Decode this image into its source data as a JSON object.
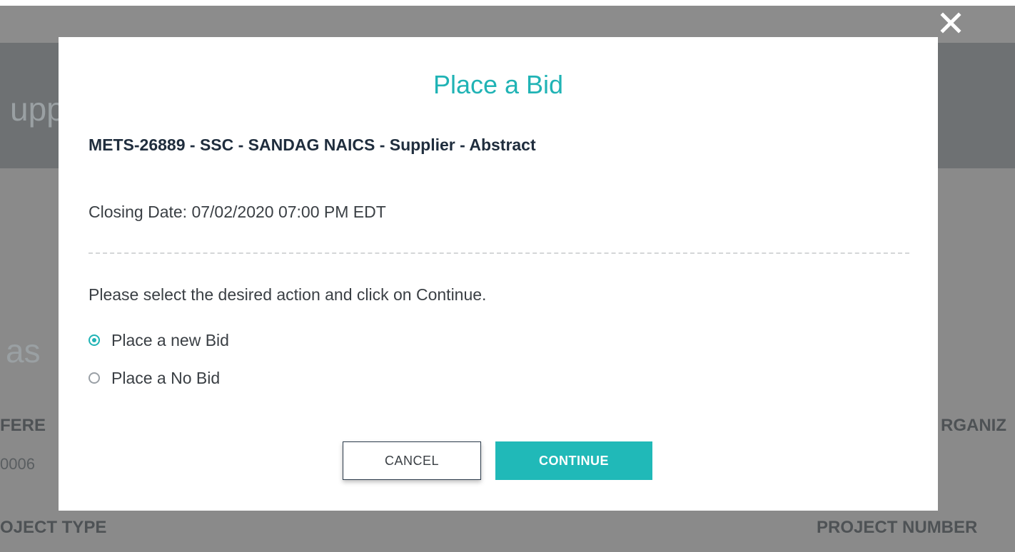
{
  "background": {
    "header_title": "upp",
    "section_title": "as",
    "reference_label": "FERE",
    "reference_value": "0006",
    "organization_label": "RGANIZ",
    "project_type_label": "OJECT TYPE",
    "project_number_label": "PROJECT NUMBER"
  },
  "modal": {
    "title": "Place a Bid",
    "bid_name": "METS-26889 - SSC - SANDAG NAICS - Supplier - Abstract",
    "closing_date": "Closing Date: 07/02/2020 07:00 PM EDT",
    "instruction": "Please select the desired action and click on Continue.",
    "options": [
      {
        "label": "Place a new Bid",
        "checked": true
      },
      {
        "label": "Place a No Bid",
        "checked": false
      }
    ],
    "cancel_label": "CANCEL",
    "continue_label": "CONTINUE"
  },
  "colors": {
    "accent": "#20b3b5",
    "overlay": "#8a8a8a"
  },
  "icons": {
    "close": "close-icon"
  }
}
